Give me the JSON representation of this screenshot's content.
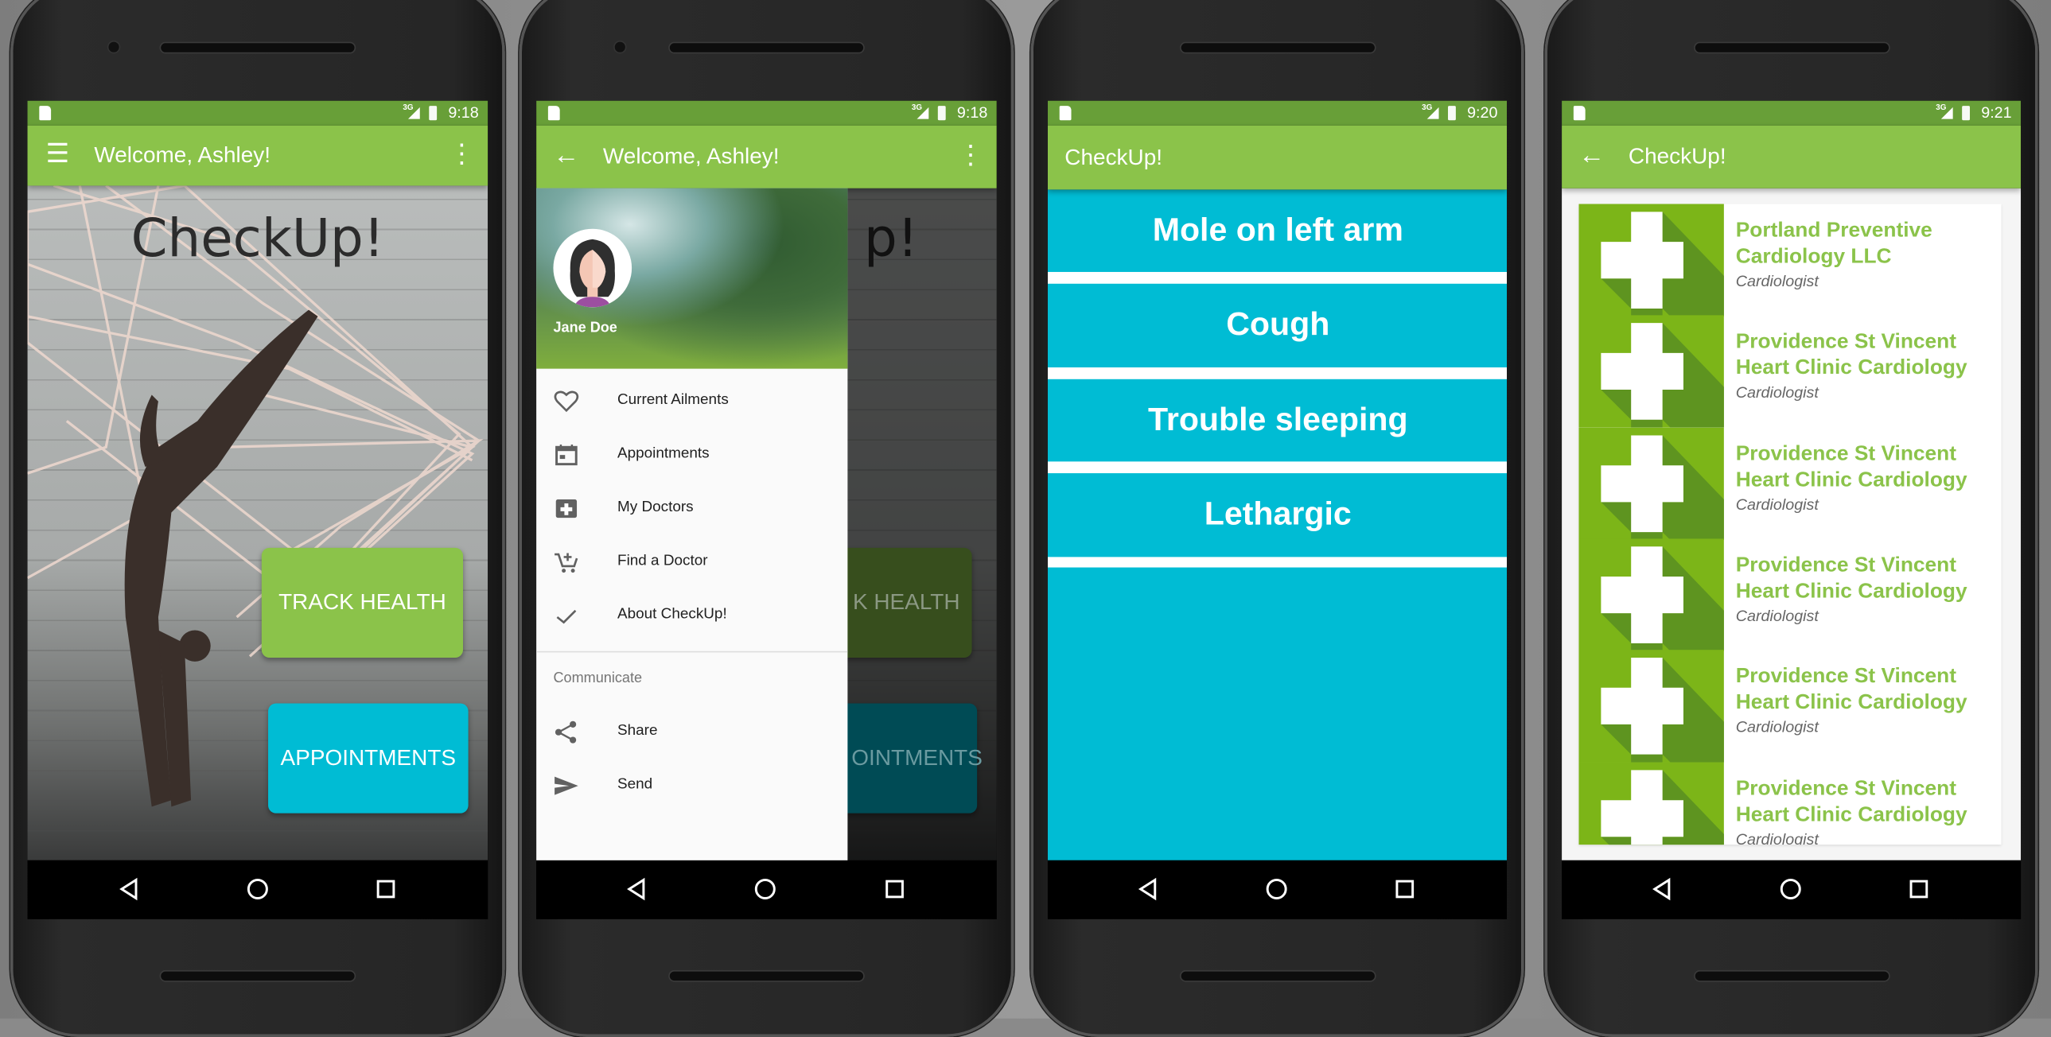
{
  "colors": {
    "primary": "#8bc34a",
    "primary_dark": "#689f38",
    "accent": "#00bcd4",
    "doctor_icon_bg": "#7cb518"
  },
  "status": {
    "network": "3G",
    "times": [
      "9:18",
      "9:18",
      "9:20",
      "9:21"
    ]
  },
  "home": {
    "toolbar_title": "Welcome, Ashley!",
    "menu_icon": "hamburger-icon",
    "overflow_icon": "more-vert-icon",
    "logo": "CheckUp!",
    "track_health": "TRACK HEALTH",
    "appointments": "APPOINTMENTS",
    "partial_logo": "p!",
    "partial_track": "K HEALTH",
    "partial_appointments": "OINTMENTS"
  },
  "drawer": {
    "user_name": "Jane Doe",
    "items": [
      {
        "label": "Current Ailments",
        "icon": "heart-outline-icon"
      },
      {
        "label": "Appointments",
        "icon": "calendar-icon"
      },
      {
        "label": "My Doctors",
        "icon": "medical-plus-icon"
      },
      {
        "label": "Find a Doctor",
        "icon": "add-cart-icon"
      },
      {
        "label": "About CheckUp!",
        "icon": "check-icon"
      }
    ],
    "section": "Communicate",
    "comm_items": [
      {
        "label": "Share",
        "icon": "share-icon"
      },
      {
        "label": "Send",
        "icon": "send-icon"
      }
    ]
  },
  "ailments": {
    "toolbar_title": "CheckUp!",
    "items": [
      "Mole on left arm",
      "Cough",
      "Trouble sleeping",
      "Lethargic"
    ]
  },
  "doctors": {
    "toolbar_title": "CheckUp!",
    "items": [
      {
        "name": "Portland Preventive Cardiology LLC",
        "specialty": "Cardiologist"
      },
      {
        "name": "Providence St Vincent Heart Clinic Cardiology",
        "specialty": "Cardiologist"
      },
      {
        "name": "Providence St Vincent Heart Clinic Cardiology",
        "specialty": "Cardiologist"
      },
      {
        "name": "Providence St Vincent Heart Clinic Cardiology",
        "specialty": "Cardiologist"
      },
      {
        "name": "Providence St Vincent Heart Clinic Cardiology",
        "specialty": "Cardiologist"
      },
      {
        "name": "Providence St Vincent Heart Clinic Cardiology",
        "specialty": "Cardiologist"
      }
    ]
  }
}
